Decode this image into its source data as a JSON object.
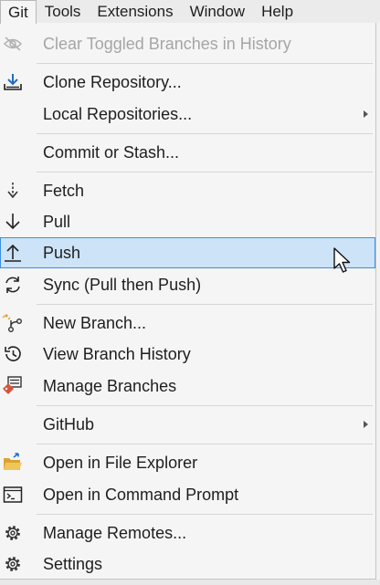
{
  "menubar": {
    "items": [
      {
        "label": "Git"
      },
      {
        "label": "Tools"
      },
      {
        "label": "Extensions"
      },
      {
        "label": "Window"
      },
      {
        "label": "Help"
      }
    ]
  },
  "menu": {
    "items": [
      {
        "label": "Clear Toggled Branches in History",
        "icon": "hidden-eye-icon",
        "disabled": true
      },
      {
        "label": "Clone Repository...",
        "icon": "clone-download-icon"
      },
      {
        "label": "Local Repositories...",
        "icon": "",
        "submenu": true
      },
      {
        "label": "Commit or Stash...",
        "icon": ""
      },
      {
        "label": "Fetch",
        "icon": "fetch-icon"
      },
      {
        "label": "Pull",
        "icon": "pull-arrow-down-icon"
      },
      {
        "label": "Push",
        "icon": "push-arrow-up-icon",
        "highlighted": true
      },
      {
        "label": "Sync (Pull then Push)",
        "icon": "sync-icon"
      },
      {
        "label": "New Branch...",
        "icon": "new-branch-icon"
      },
      {
        "label": "View Branch History",
        "icon": "history-icon"
      },
      {
        "label": "Manage Branches",
        "icon": "manage-branches-icon"
      },
      {
        "label": "GitHub",
        "icon": "",
        "submenu": true
      },
      {
        "label": "Open in File Explorer",
        "icon": "folder-open-icon"
      },
      {
        "label": "Open in Command Prompt",
        "icon": "command-prompt-icon"
      },
      {
        "label": "Manage Remotes...",
        "icon": "gear-icon"
      },
      {
        "label": "Settings",
        "icon": "gear-icon"
      }
    ]
  },
  "colors": {
    "highlight_fill": "#cde3f7",
    "highlight_border": "#3c8ee0",
    "disabled_text": "#a5a5a5",
    "accent_blue": "#1e6fc0"
  }
}
